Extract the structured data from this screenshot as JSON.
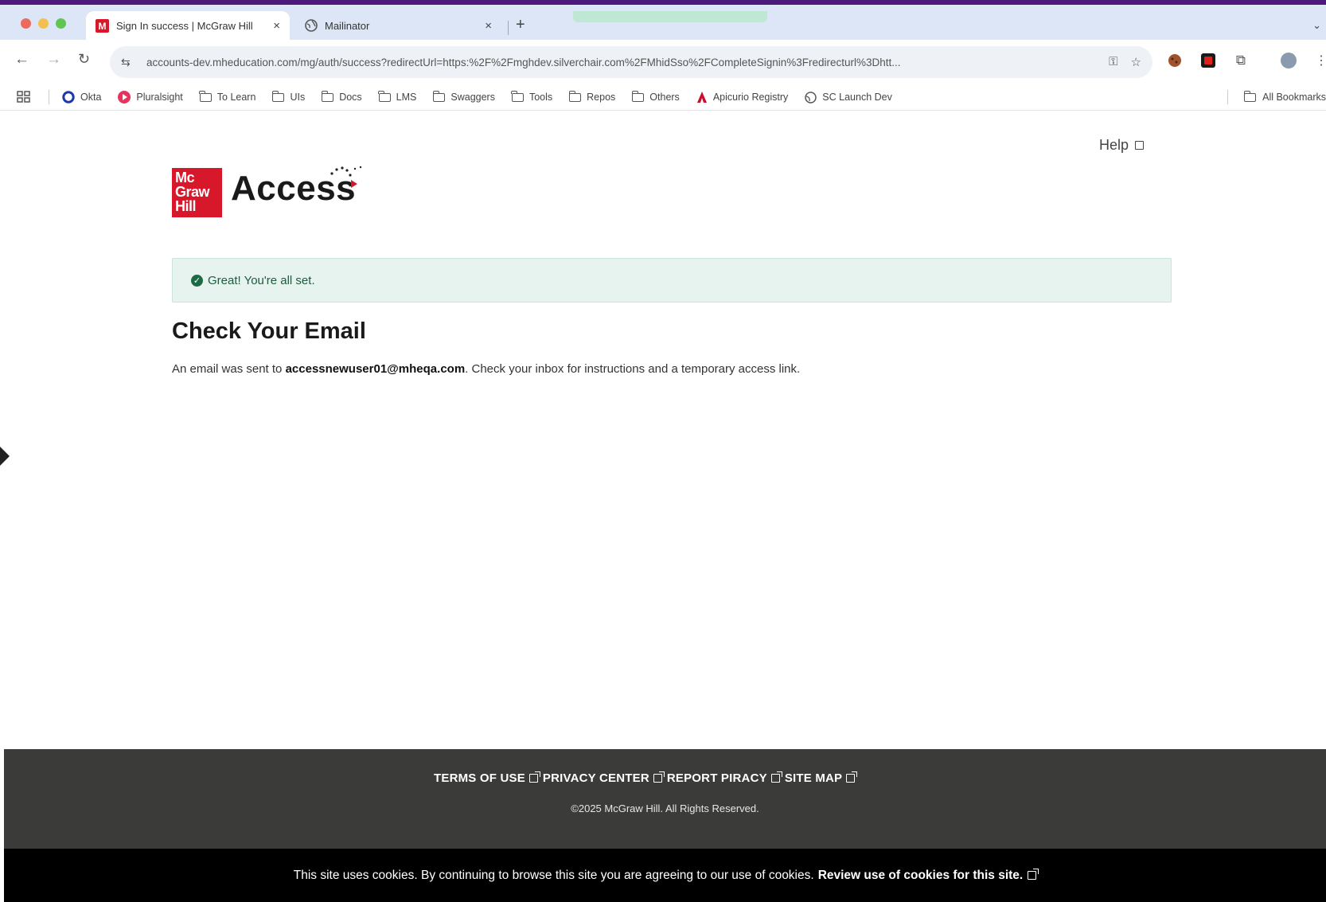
{
  "browser": {
    "tabs": [
      {
        "title": "Sign In success | McGraw Hill",
        "close": "×"
      },
      {
        "title": "Mailinator",
        "close": "×"
      }
    ],
    "new_tab": "+",
    "url": "accounts-dev.mheducation.com/mg/auth/success?redirectUrl=https:%2F%2Fmghdev.silverchair.com%2FMhidSso%2FCompleteSignin%3Fredirecturl%3Dhtt...",
    "bookmarks": [
      {
        "label": "Okta",
        "icon": "okta-icon"
      },
      {
        "label": "Pluralsight",
        "icon": "pluralsight-icon"
      },
      {
        "label": "To Learn",
        "icon": "folder-icon"
      },
      {
        "label": "UIs",
        "icon": "folder-icon"
      },
      {
        "label": "Docs",
        "icon": "folder-icon"
      },
      {
        "label": "LMS",
        "icon": "folder-icon"
      },
      {
        "label": "Swaggers",
        "icon": "folder-icon"
      },
      {
        "label": "Tools",
        "icon": "folder-icon"
      },
      {
        "label": "Repos",
        "icon": "folder-icon"
      },
      {
        "label": "Others",
        "icon": "folder-icon"
      },
      {
        "label": "Apicurio Registry",
        "icon": "apicurio-icon"
      },
      {
        "label": "SC Launch Dev",
        "icon": "globe-icon"
      }
    ],
    "all_bookmarks": "All Bookmarks"
  },
  "page": {
    "help": "Help",
    "logo": {
      "line1": "Mc",
      "line2": "Graw",
      "line3": "Hill",
      "product": "Access"
    },
    "alert": "Great! You're all set.",
    "heading": "Check Your Email",
    "message_prefix": "An email was sent to ",
    "email": "accessnewuser01@mheqa.com",
    "message_suffix": ". Check your inbox for instructions and a temporary access link."
  },
  "footer": {
    "links": [
      "TERMS OF USE",
      "PRIVACY CENTER",
      "REPORT PIRACY",
      "SITE MAP"
    ],
    "copyright": "©2025 McGraw Hill. All Rights Reserved."
  },
  "cookie_banner": {
    "text": "This site uses cookies. By continuing to browse this site you are agreeing to our use of cookies.",
    "link": "Review use of cookies for this site."
  },
  "colors": {
    "brand_red": "#d6182a",
    "success_green": "#1d6b45",
    "footer_bg": "#3b3c3a"
  }
}
